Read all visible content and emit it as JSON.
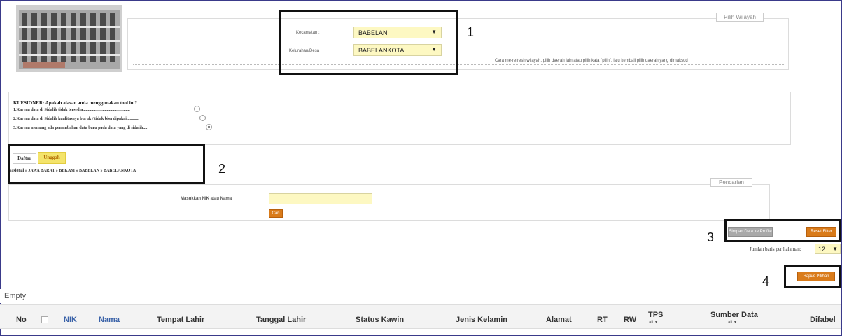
{
  "region": {
    "pick_button": "Pilih Wilayah",
    "kecamatan_label": "Kecamatan :",
    "kecamatan_value": "BABELAN",
    "kelurahan_label": "Kelurahan/Desa :",
    "kelurahan_value": "BABELANKOTA",
    "hint": "Cara me-refresh wilayah, pilih daerah lain atau pilih kata \"pilih\", lalu kembali pilih daerah yang dimaksud"
  },
  "questionnaire": {
    "title": "KUESIONER: Apakah alasan anda menggunakan tool ini?",
    "options": [
      "1.Karena data di Sidalih tidak tersedia.............................................",
      "2.Karena data di Sidalih kualitasnya buruk / tidak bisa dipakai............",
      "3.Karena memang ada penambahan data baru pada data yang di sidalih...."
    ]
  },
  "tabs": {
    "daftar": "Daftar",
    "unggah": "Unggah"
  },
  "breadcrumb": "Nasional » JAWA BARAT » BEKASI » BABELAN » BABELANKOTA",
  "search": {
    "legend": "Pencarian",
    "label": "Masukkan NIK atau Nama",
    "button": "Cari"
  },
  "actions": {
    "save_button": "Simpan Data ke Profile",
    "reset_button": "Reset Filter",
    "rows_label": "Jumlah baris per halaman:",
    "rows_value": "12",
    "delete_button": "Hapus Pilihan"
  },
  "table": {
    "columns": {
      "no": "No",
      "nik": "NIK",
      "nama": "Nama",
      "tempat": "Tempat Lahir",
      "tanggal": "Tanggal Lahir",
      "status": "Status Kawin",
      "jenis": "Jenis Kelamin",
      "alamat": "Alamat",
      "rt": "RT",
      "rw": "RW",
      "tps": "TPS",
      "sumber": "Sumber Data",
      "difabel": "Difabel"
    },
    "tps_filter": "all ▼",
    "sumber_filter": "all ▼",
    "empty_text": "Empty"
  },
  "annotations": [
    "1",
    "2",
    "3",
    "4"
  ]
}
